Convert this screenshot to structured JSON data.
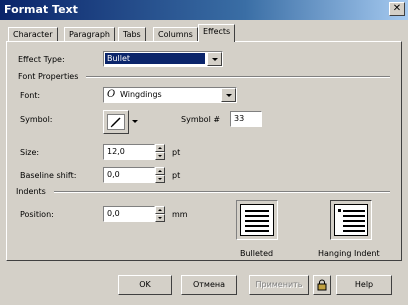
{
  "window": {
    "title": "Format Text",
    "close_glyph": "✕"
  },
  "tabs": [
    {
      "label": "Character"
    },
    {
      "label": "Paragraph"
    },
    {
      "label": "Tabs"
    },
    {
      "label": "Columns"
    },
    {
      "label": "Effects",
      "active": true
    }
  ],
  "effect": {
    "label": "Effect Type:",
    "value": "Bullet"
  },
  "font_properties": {
    "heading": "Font Properties",
    "font_label": "Font:",
    "font_icon": "O",
    "font_value": "Wingdings",
    "symbol_label": "Symbol:",
    "symbol_number_label": "Symbol #",
    "symbol_number_value": "33",
    "size_label": "Size:",
    "size_value": "12,0",
    "size_unit": "pt",
    "baseline_label": "Baseline shift:",
    "baseline_value": "0,0",
    "baseline_unit": "pt"
  },
  "indents": {
    "heading": "Indents",
    "position_label": "Position:",
    "position_value": "0,0",
    "position_unit": "mm",
    "bulleted_label": "Bulleted",
    "hanging_label": "Hanging Indent"
  },
  "buttons": {
    "ok": "OK",
    "cancel": "Отмена",
    "apply": "Применить",
    "help": "Help"
  }
}
